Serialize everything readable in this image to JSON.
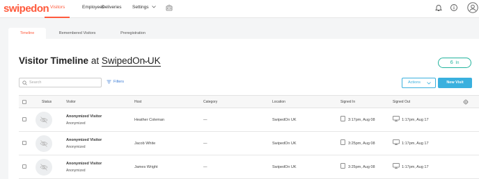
{
  "nav": {
    "logo": "swipedon",
    "items": [
      "Visitors",
      "Employees",
      "Deliveries",
      "Settings"
    ],
    "active_color": "#ff5a3c"
  },
  "tabs": [
    "Timeline",
    "Remembered Visitors",
    "Preregistration"
  ],
  "page": {
    "title_bold": "Visitor Timeline",
    "title_at": "at",
    "location": "SwipedOn UK",
    "in_count": "6",
    "in_label": "In"
  },
  "toolbar": {
    "search_placeholder": "Search",
    "filters": "Filters",
    "actions": "Actions",
    "new_visit": "New Visit"
  },
  "table": {
    "headers": [
      "Status",
      "Visitor",
      "Host",
      "Category",
      "Location",
      "Signed In",
      "Signed Out"
    ],
    "rows": [
      {
        "visitor": "Anonymized Visitor",
        "company": "Anonymized",
        "host": "Heather Coleman",
        "category": "—",
        "location": "SwipedOn UK",
        "signed_in": "3:17pm, Aug 08",
        "signed_out": "1:17pm, Aug 17"
      },
      {
        "visitor": "Anonymized Visitor",
        "company": "Anonymized",
        "host": "Jacob White",
        "category": "—",
        "location": "SwipedOn UK",
        "signed_in": "3:25pm, Aug 08",
        "signed_out": "1:17pm, Aug 17"
      },
      {
        "visitor": "Anonymized Visitor",
        "company": "Anonymized",
        "host": "James Wright",
        "category": "—",
        "location": "SwipedOn UK",
        "signed_in": "3:25pm, Aug 08",
        "signed_out": "1:17pm, Aug 17"
      }
    ]
  },
  "colors": {
    "accent": "#ff5a3c",
    "teal": "#22b39c",
    "blue": "#3ab0de"
  }
}
